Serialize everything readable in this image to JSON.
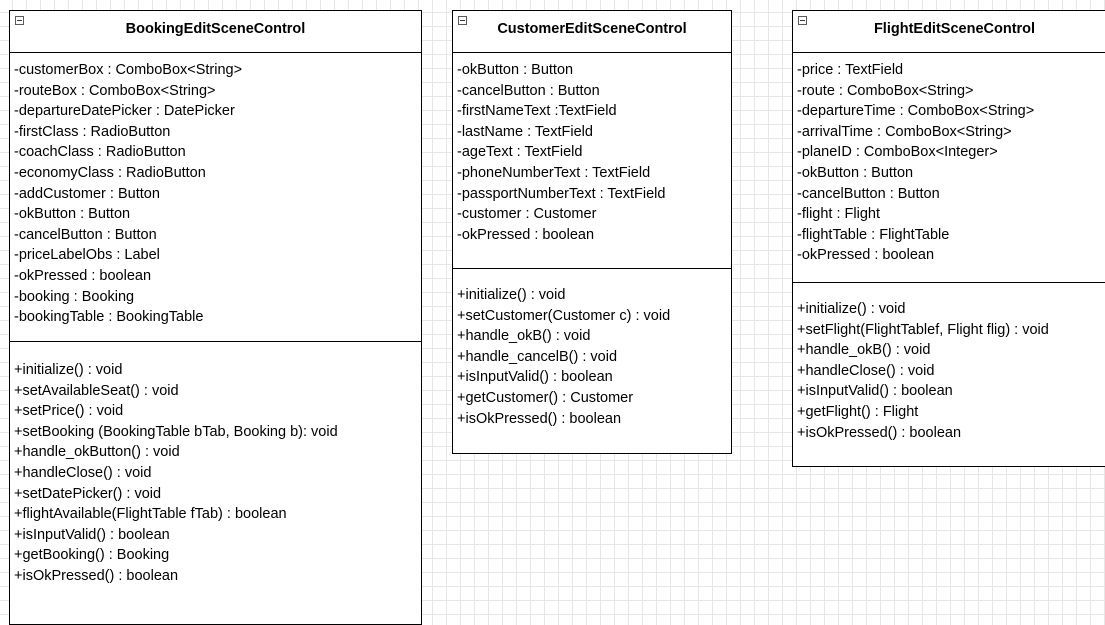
{
  "classes": [
    {
      "name": "BookingEditSceneControl",
      "attributes": [
        "-customerBox : ComboBox<String>",
        "-routeBox : ComboBox<String>",
        "-departureDatePicker : DatePicker",
        "-firstClass : RadioButton",
        "-coachClass : RadioButton",
        "-economyClass : RadioButton",
        "-addCustomer : Button",
        "-okButton : Button",
        "-cancelButton : Button",
        "-priceLabelObs : Label",
        "-okPressed : boolean",
        "-booking : Booking",
        "-bookingTable : BookingTable"
      ],
      "operations": [
        "+initialize() : void",
        "+setAvailableSeat() : void",
        "+setPrice() : void",
        "+setBooking (BookingTable bTab, Booking b): void",
        "+handle_okButton() : void",
        "+handleClose() : void",
        "+setDatePicker() : void",
        "+flightAvailable(FlightTable fTab) : boolean",
        "+isInputValid() : boolean",
        "+getBooking() : Booking",
        "+isOkPressed() : boolean"
      ]
    },
    {
      "name": "CustomerEditSceneControl",
      "attributes": [
        "-okButton : Button",
        "-cancelButton : Button",
        "-firstNameText :TextField",
        "-lastName : TextField",
        "-ageText : TextField",
        "-phoneNumberText : TextField",
        "-passportNumberText : TextField",
        "-customer : Customer",
        "-okPressed : boolean"
      ],
      "operations": [
        "+initialize() : void",
        "+setCustomer(Customer c) : void",
        "+handle_okB() : void",
        "+handle_cancelB() : void",
        "+isInputValid() : boolean",
        "+getCustomer() : Customer",
        "+isOkPressed() : boolean"
      ]
    },
    {
      "name": "FlightEditSceneControl",
      "attributes": [
        "-price : TextField",
        "-route : ComboBox<String>",
        "-departureTime : ComboBox<String>",
        "-arrivalTime : ComboBox<String>",
        "-planeID : ComboBox<Integer>",
        "-okButton : Button",
        "-cancelButton : Button",
        "-flight : Flight",
        "-flightTable : FlightTable",
        "-okPressed : boolean"
      ],
      "operations": [
        "+initialize() : void",
        "+setFlight(FlightTablef, Flight flig) : void",
        "+handle_okB() : void",
        "+handleClose() : void",
        "+isInputValid() : boolean",
        "+getFlight() : Flight",
        "+isOkPressed() : boolean"
      ]
    }
  ],
  "colors": {
    "border": "#000000",
    "box_fill": "#ffffff",
    "grid": "#e6e6e6"
  }
}
